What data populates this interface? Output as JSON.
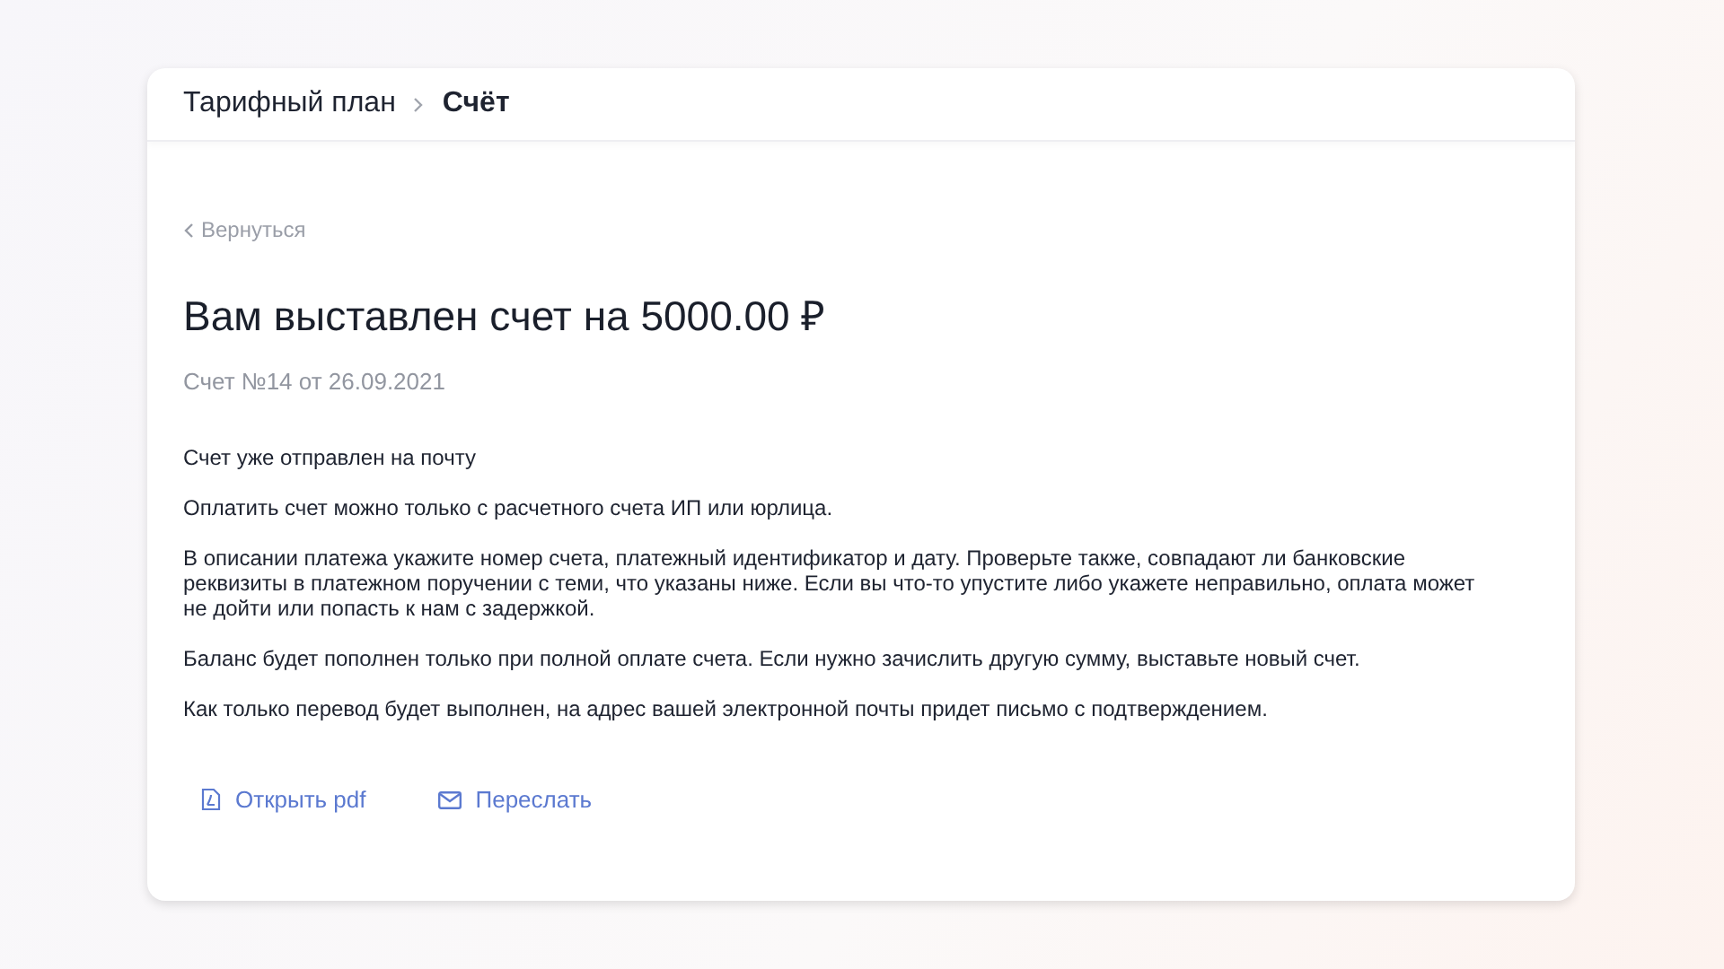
{
  "breadcrumbs": [
    {
      "label": "Тарифный план",
      "current": false
    },
    {
      "label": "Счёт",
      "current": true
    }
  ],
  "back_link": {
    "label": "Вернуться"
  },
  "title": "Вам выставлен счет на 5000.00 ₽",
  "subtitle": "Счет №14 от 26.09.2021",
  "paragraphs": [
    "Счет уже отправлен на почту",
    "Оплатить счет можно только с расчетного счета ИП или юрлица.",
    "В описании платежа укажите номер счета, платежный идентификатор и дату. Проверьте также, совпадают ли банковские реквизиты в платежном поручении с теми, что указаны ниже. Если вы что-то упустите либо укажете неправильно, оплата может не дойти или попасть к нам с задержкой.",
    "Баланс будет пополнен только при полной оплате счета. Если нужно зачислить другую сумму, выставьте новый счет.",
    "Как только перевод будет выполнен, на адрес вашей электронной почты придет письмо с подтверждением."
  ],
  "actions": [
    {
      "label": "Открыть pdf",
      "kind": "pdf"
    },
    {
      "label": "Переслать",
      "kind": "mail"
    }
  ]
}
